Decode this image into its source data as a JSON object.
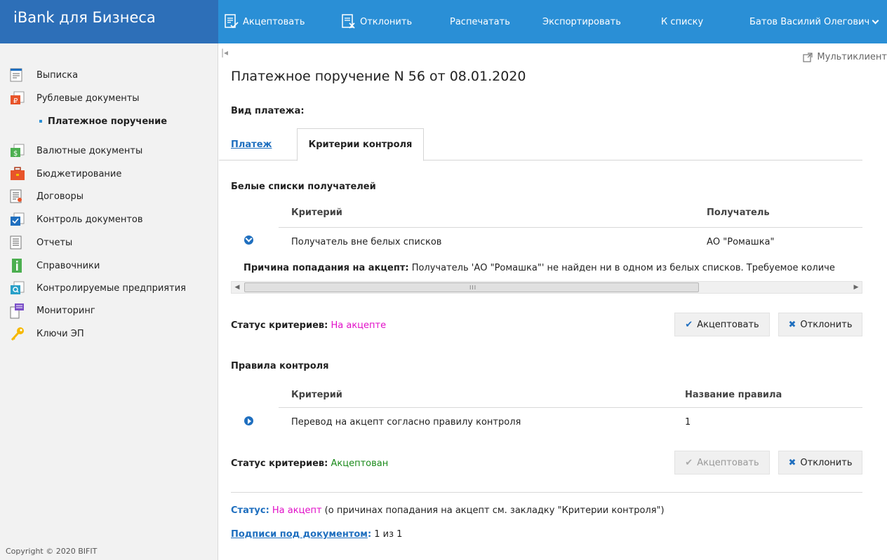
{
  "app": {
    "brand": "iBank для Бизнеса"
  },
  "menu": {
    "accept": "Акцептовать",
    "reject": "Отклонить",
    "print": "Распечатать",
    "export": "Экспортировать",
    "to_list": "К списку",
    "user": "Батов Василий Олегович"
  },
  "sidebar": {
    "items": [
      {
        "label": "Выписка",
        "icon": "statement-icon"
      },
      {
        "label": "Рублевые документы",
        "icon": "ruble-docs-icon"
      },
      {
        "label": "Платежное поручение",
        "icon": "bullet"
      },
      {
        "label": "Валютные документы",
        "icon": "currency-docs-icon"
      },
      {
        "label": "Бюджетирование",
        "icon": "briefcase-icon"
      },
      {
        "label": "Договоры",
        "icon": "contracts-icon"
      },
      {
        "label": "Контроль документов",
        "icon": "doc-control-icon"
      },
      {
        "label": "Отчеты",
        "icon": "reports-icon"
      },
      {
        "label": "Справочники",
        "icon": "info-icon"
      },
      {
        "label": "Контролируемые предприятия",
        "icon": "controlled-companies-icon"
      },
      {
        "label": "Мониторинг",
        "icon": "monitoring-icon"
      },
      {
        "label": "Ключи ЭП",
        "icon": "key-icon"
      }
    ],
    "copyright": "Copyright © 2020 BIFIT"
  },
  "main": {
    "collapse": "|◂",
    "multiclient": "Мультиклиент",
    "title": "Платежное поручение N 56 от 08.01.2020",
    "payment_type_label": "Вид платежа:",
    "tabs": [
      {
        "label": "Платеж"
      },
      {
        "label": "Критерии контроля"
      }
    ],
    "whitelist": {
      "heading": "Белые списки получателей",
      "col_criterion": "Критерий",
      "col_recipient": "Получатель",
      "row_criterion": "Получатель вне белых списков",
      "row_recipient": "АО \"Ромашка\"",
      "reason_label": "Причина попадания на акцепт:",
      "reason_text": "Получатель 'АО \"Ромашка\"' не найден ни в одном из белых списков. Требуемое количе",
      "scroll_grip": "III",
      "status_label": "Статус критериев:",
      "status_value": "На акцепте",
      "accept": "Акцептовать",
      "reject": "Отклонить"
    },
    "rules": {
      "heading": "Правила контроля",
      "col_criterion": "Критерий",
      "col_rule": "Название правила",
      "row_criterion": "Перевод на акцепт согласно правилу контроля",
      "row_rule": "1",
      "status_label": "Статус критериев:",
      "status_value": "Акцептован",
      "accept": "Акцептовать",
      "reject": "Отклонить"
    },
    "status": {
      "label": "Статус:",
      "value": "На акцепт",
      "note": "(о причинах попадания на акцепт см. закладку \"Критерии контроля\")"
    },
    "signatures": {
      "label": "Подписи под документом",
      "value": "1 из 1"
    }
  },
  "colors": {
    "brand_bar": "#2d6fb8",
    "menu_bar": "#2a8fd6",
    "link": "#1f6fbf",
    "status_pending": "#e10fc8",
    "status_accepted": "#1a8a1a"
  }
}
